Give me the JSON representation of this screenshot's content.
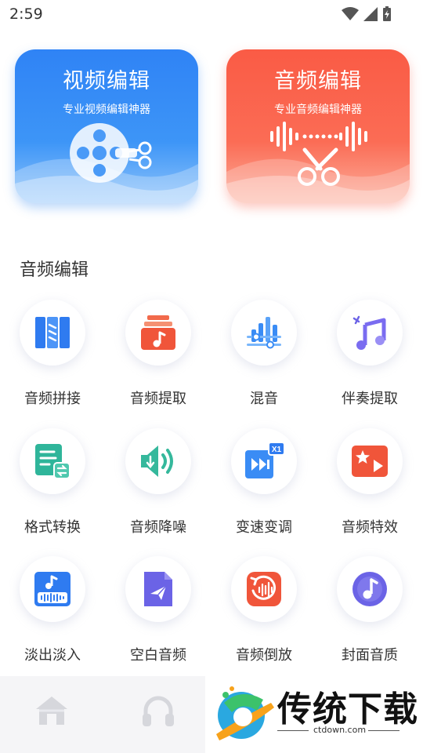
{
  "status_bar": {
    "time": "2:59"
  },
  "cards": {
    "video": {
      "title": "视频编辑",
      "subtitle": "专业视频编辑神器"
    },
    "audio": {
      "title": "音频编辑",
      "subtitle": "专业音频编辑神器"
    }
  },
  "section": {
    "title": "音频编辑"
  },
  "tools": [
    {
      "label": "音频拼接",
      "icon": "audio-splice-icon"
    },
    {
      "label": "音频提取",
      "icon": "audio-extract-icon"
    },
    {
      "label": "混音",
      "icon": "mix-icon"
    },
    {
      "label": "伴奏提取",
      "icon": "accompaniment-extract-icon"
    },
    {
      "label": "格式转换",
      "icon": "format-convert-icon"
    },
    {
      "label": "音频降噪",
      "icon": "noise-reduction-icon"
    },
    {
      "label": "变速变调",
      "icon": "speed-pitch-icon"
    },
    {
      "label": "音频特效",
      "icon": "audio-effects-icon"
    },
    {
      "label": "淡出淡入",
      "icon": "fade-icon"
    },
    {
      "label": "空白音频",
      "icon": "blank-audio-icon"
    },
    {
      "label": "音频倒放",
      "icon": "audio-reverse-icon"
    },
    {
      "label": "封面音质",
      "icon": "cover-quality-icon"
    }
  ],
  "watermark": {
    "brand": "传统下载",
    "url": "ctdown.com"
  },
  "colors": {
    "blue": "#2f83f5",
    "red": "#fa5b45",
    "teal": "#2fb59a",
    "purple": "#6b63e6"
  }
}
